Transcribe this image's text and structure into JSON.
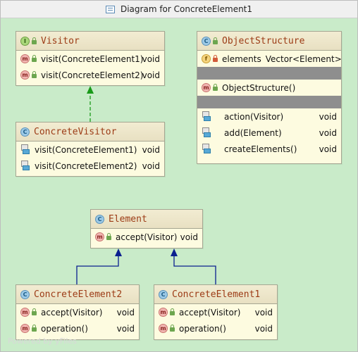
{
  "window": {
    "title": "Diagram for ConcreteElement1"
  },
  "nodes": {
    "visitor": {
      "badge": "I",
      "name": "Visitor",
      "methods": [
        {
          "label": "visit(ConcreteElement1)",
          "type": "void"
        },
        {
          "label": "visit(ConcreteElement2)",
          "type": "void"
        }
      ]
    },
    "concrete_visitor": {
      "badge": "C",
      "name": "ConcreteVisitor",
      "methods": [
        {
          "label": "visit(ConcreteElement1)",
          "type": "void"
        },
        {
          "label": "visit(ConcreteElement2)",
          "type": "void"
        }
      ]
    },
    "object_structure": {
      "badge": "C",
      "name": "ObjectStructure",
      "field": {
        "label": "elements",
        "type": "Vector<Element>"
      },
      "constructor": {
        "label": "ObjectStructure()"
      },
      "methods": [
        {
          "label": "action(Visitor)",
          "type": "void"
        },
        {
          "label": "add(Element)",
          "type": "void"
        },
        {
          "label": "createElements()",
          "type": "void"
        }
      ]
    },
    "element": {
      "badge": "C",
      "name": "Element",
      "methods": [
        {
          "label": "accept(Visitor)",
          "type": "void"
        }
      ]
    },
    "concrete_element2": {
      "badge": "C",
      "name": "ConcreteElement2",
      "methods": [
        {
          "label": "accept(Visitor)",
          "type": "void"
        },
        {
          "label": "operation()",
          "type": "void"
        }
      ]
    },
    "concrete_element1": {
      "badge": "C",
      "name": "ConcreteElement1",
      "methods": [
        {
          "label": "accept(Visitor)",
          "type": "void"
        },
        {
          "label": "operation()",
          "type": "void"
        }
      ]
    }
  },
  "badges": {
    "method": "m",
    "field": "f"
  },
  "watermark": "Powered by yFiles",
  "colors": {
    "canvas": "#c9ebc9",
    "node_fill": "#fdfbe0",
    "class_name": "#9c3b15",
    "implements_edge": "#1a9a1a",
    "extends_edge": "#0a1f8f"
  }
}
